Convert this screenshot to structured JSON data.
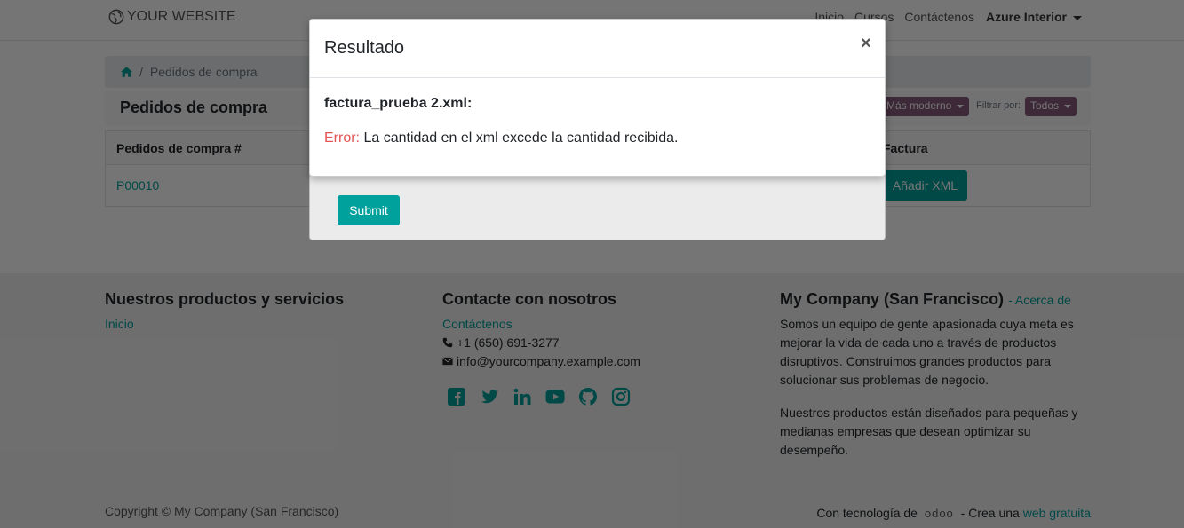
{
  "navbar": {
    "brand": "YOUR WEBSITE",
    "links": [
      "Inicio",
      "Cursos",
      "Contáctenos"
    ],
    "user": "Azure Interior"
  },
  "breadcrumb": {
    "current": "Pedidos de compra",
    "separator": "/"
  },
  "page": {
    "title": "Pedidos de compra",
    "sort_value": "Más moderno",
    "filter_label": "Filtrar por:",
    "filter_value": "Todos"
  },
  "table": {
    "headers": [
      "Pedidos de compra #",
      "Factura"
    ],
    "rows": [
      {
        "order": "P00010",
        "action": "Añadir XML"
      }
    ]
  },
  "footer": {
    "col1": {
      "heading": "Nuestros productos y servicios",
      "link": "Inicio"
    },
    "col2": {
      "heading": "Contacte con nosotros",
      "link": "Contáctenos",
      "phone": "+1 (650) 691-3277",
      "email": "info@yourcompany.example.com"
    },
    "col3": {
      "heading": "My Company (San Francisco)",
      "about_link": "- Acerca de",
      "p1": "Somos un equipo de gente apasionada cuya meta es mejorar la vida de cada uno a través de productos disruptivos. Construimos grandes productos para solucionar sus problemas de negocio.",
      "p2": "Nuestros productos están diseñados para pequeñas y medianas empresas que desean optimizar su desempeño."
    },
    "copyright": "Copyright © My Company (San Francisco)",
    "powered_prefix": "Con tecnología de",
    "powered_brand": "odoo",
    "powered_mid": "- Crea una",
    "powered_link": "web gratuita"
  },
  "upload_modal": {
    "submit_label": "Submit"
  },
  "result_modal": {
    "title": "Resultado",
    "close": "×",
    "filename": "factura_prueba 2.xml:",
    "error_label": "Error:",
    "error_message": "La cantidad en el xml excede la cantidad recibida."
  },
  "colors": {
    "primary": "#00A09D",
    "secondary": "#875A7B",
    "error": "#e55353"
  }
}
